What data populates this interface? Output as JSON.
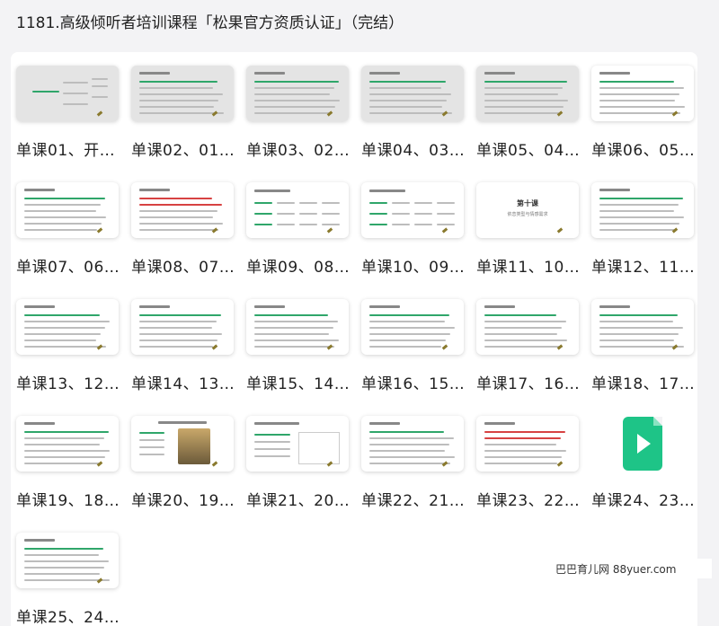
{
  "page": {
    "title": "1181.高级倾听者培训课程「松果官方资质认证」（完结）"
  },
  "files": [
    {
      "label": "单课01、开…",
      "thumb": "mindmap"
    },
    {
      "label": "单课02、01…",
      "thumb": "text-gray"
    },
    {
      "label": "单课03、02…",
      "thumb": "text-gray"
    },
    {
      "label": "单课04、03…",
      "thumb": "text-gray"
    },
    {
      "label": "单课05、04…",
      "thumb": "text-gray"
    },
    {
      "label": "单课06、05…",
      "thumb": "text"
    },
    {
      "label": "单课07、06…",
      "thumb": "text"
    },
    {
      "label": "单课08、07…",
      "thumb": "text-red"
    },
    {
      "label": "单课09、08…",
      "thumb": "flow"
    },
    {
      "label": "单课10、09…",
      "thumb": "flow"
    },
    {
      "label": "单课11、10…",
      "thumb": "chapter",
      "chapter_title": "第十课",
      "chapter_sub": "依恋类型与情感需求"
    },
    {
      "label": "单课12、11…",
      "thumb": "text"
    },
    {
      "label": "单课13、12…",
      "thumb": "text"
    },
    {
      "label": "单课14、13…",
      "thumb": "text"
    },
    {
      "label": "单课15、14…",
      "thumb": "text"
    },
    {
      "label": "单课16、15…",
      "thumb": "text"
    },
    {
      "label": "单课17、16…",
      "thumb": "text"
    },
    {
      "label": "单课18、17…",
      "thumb": "text"
    },
    {
      "label": "单课19、18…",
      "thumb": "text"
    },
    {
      "label": "单课20、19…",
      "thumb": "image"
    },
    {
      "label": "单课21、20…",
      "thumb": "diagram"
    },
    {
      "label": "单课22、21…",
      "thumb": "text"
    },
    {
      "label": "单课23、22…",
      "thumb": "text-red"
    },
    {
      "label": "单课24、23…",
      "thumb": "video",
      "icon": "video-file-icon"
    },
    {
      "label": "单课25、24…",
      "thumb": "text"
    }
  ],
  "watermark": {
    "text": "巴巴育儿网 88yuer.com"
  }
}
